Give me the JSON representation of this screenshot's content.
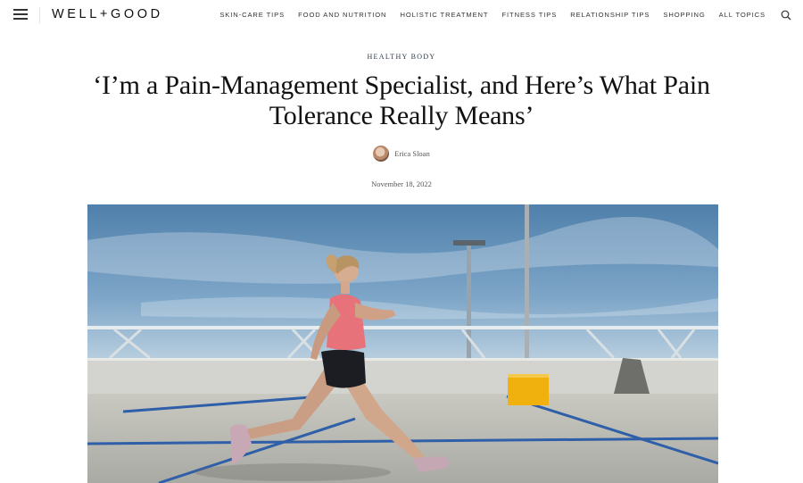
{
  "header": {
    "logo": "WELL+GOOD",
    "nav": [
      "SKIN-CARE TIPS",
      "FOOD AND NUTRITION",
      "HOLISTIC TREATMENT",
      "FITNESS TIPS",
      "RELATIONSHIP TIPS",
      "SHOPPING",
      "ALL TOPICS"
    ],
    "icons": {
      "menu": "hamburger-menu-icon",
      "search": "search-icon"
    }
  },
  "article": {
    "kicker": "HEALTHY BODY",
    "title": "‘I’m a Pain-Management Specialist, and Here’s What Pain Tolerance Really Means’",
    "author": "Erica Sloan",
    "date": "November 18, 2022"
  },
  "colors": {
    "kicker": "#2c3a4a",
    "sky": "#5f8fb8",
    "court_line": "#2f5fa8"
  }
}
